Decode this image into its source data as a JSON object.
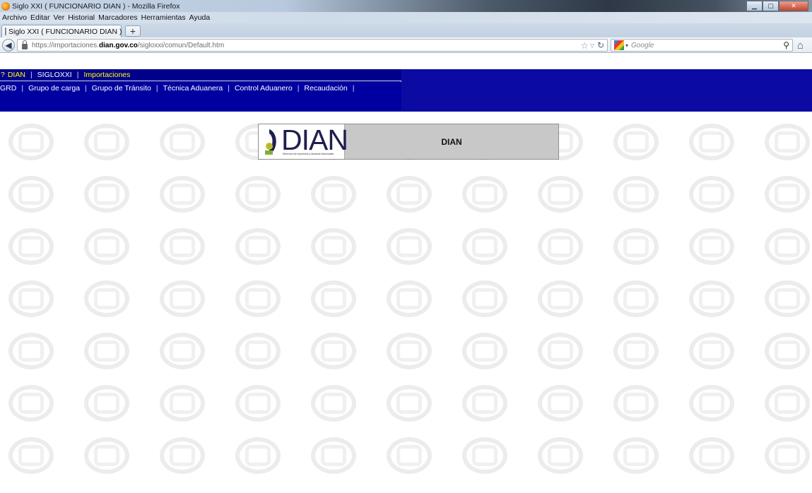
{
  "browser": {
    "window_title": "Siglo XXI ( FUNCIONARIO DIAN ) - Mozilla Firefox",
    "menu": [
      "Archivo",
      "Editar",
      "Ver",
      "Historial",
      "Marcadores",
      "Herramientas",
      "Ayuda"
    ],
    "tab_title": "Siglo XXI ( FUNCIONARIO DIAN )",
    "new_tab_label": "+",
    "url_prefix": "https://importaciones.",
    "url_domain": "dian.gov.co",
    "url_path": "/sigloxxi/comun/Default.htm",
    "search_placeholder": "Google"
  },
  "top_nav": {
    "help": "?",
    "row1": [
      "DIAN",
      "SIGLOXXI",
      "Importaciones"
    ],
    "row2": [
      "GRD",
      "Grupo de carga",
      "Grupo de Tránsito",
      "Técnica Aduanera",
      "Control Aduanero",
      "Recaudación"
    ],
    "separator": "|",
    "colors": {
      "bar": "#00008b",
      "active": "#ffff00"
    }
  },
  "banner": {
    "logo_text": "DIAN",
    "logo_sub": "Dirección de Impuestos y Aduanas Nacionales",
    "title": "DIAN"
  }
}
